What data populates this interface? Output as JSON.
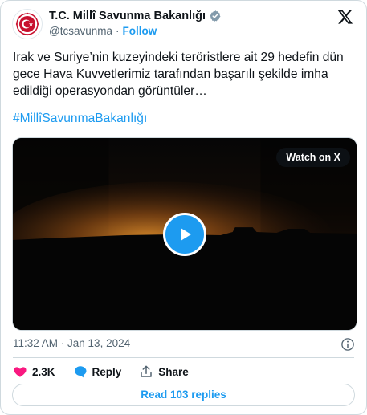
{
  "account": {
    "name": "T.C. Millî Savunma Bakanlığı",
    "handle": "@tcsavunma",
    "separator": "·",
    "follow_label": "Follow",
    "avatar_icon": "turkish-emblem-icon",
    "verified_icon": "verified-badge-icon",
    "platform_icon": "x-logo-icon"
  },
  "tweet": {
    "text": "Irak ve Suriye’nin kuzeyindeki teröristlere ait 29 hedefin dün gece Hava Kuvvetlerimiz tarafından başarılı şekilde imha edildiği operasyondan görüntüler…",
    "hashtag": "#MillîSavunmaBakanlığı",
    "timestamp": "11:32 AM · Jan 13, 2024"
  },
  "media": {
    "watch_label": "Watch on X",
    "play_icon": "play-icon"
  },
  "actions": {
    "like_count": "2.3K",
    "reply_label": "Reply",
    "share_label": "Share",
    "read_replies_label": "Read 103 replies"
  },
  "colors": {
    "accent": "#1d9bf0",
    "like": "#f91880",
    "text": "#0f1419",
    "muted": "#536471",
    "border": "#cfd9de"
  }
}
